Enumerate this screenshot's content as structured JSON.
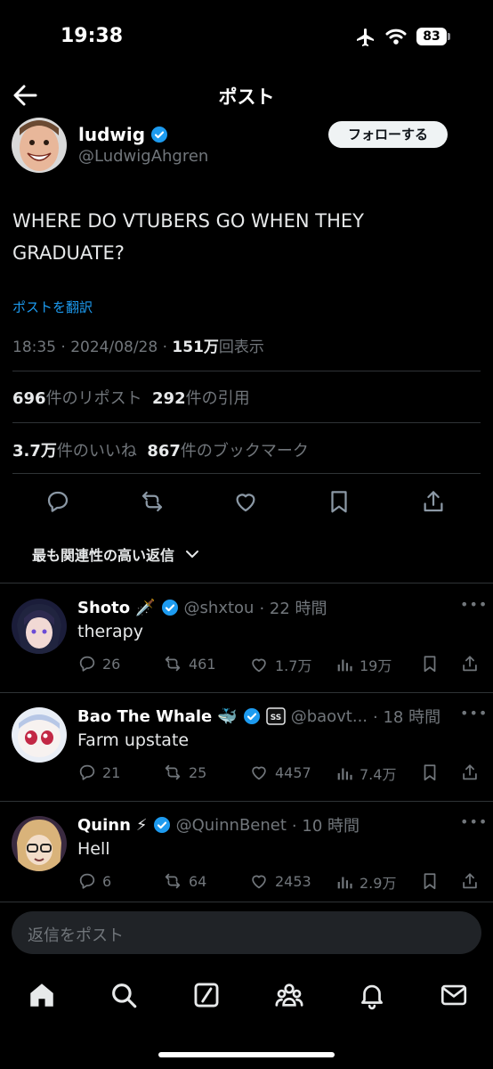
{
  "status_bar": {
    "time": "19:38",
    "battery": "83"
  },
  "nav": {
    "title": "ポスト"
  },
  "author": {
    "name": "ludwig",
    "handle": "@LudwigAhgren",
    "follow_label": "フォローする"
  },
  "tweet": {
    "text_line1": "WHERE DO VTUBERS GO WHEN THEY",
    "text_line2": "GRADUATE?",
    "translate": "ポストを翻訳",
    "timestamp": "18:35 · 2024/08/28 · ",
    "views_count": "151万",
    "views_label": "回表示"
  },
  "stats": {
    "reposts_count": "696",
    "reposts_label": "件のリポスト",
    "quotes_count": "292",
    "quotes_label": "件の引用",
    "likes_count": "3.7万",
    "likes_label": "件のいいね",
    "bookmarks_count": "867",
    "bookmarks_label": "件のブックマーク"
  },
  "sort_label": "最も関連性の高い返信",
  "replies": [
    {
      "name": "Shoto",
      "emoji": "🗡️",
      "handle": "@shxtou",
      "time": "· 22 時間",
      "text": "therapy",
      "replies": "26",
      "reposts": "461",
      "likes": "1.7万",
      "views": "19万"
    },
    {
      "name": "Bao The Whale",
      "emoji": "🐳",
      "handle": "@baovt...",
      "time": "· 18 時間",
      "text": "Farm upstate",
      "replies": "21",
      "reposts": "25",
      "likes": "4457",
      "views": "7.4万"
    },
    {
      "name": "Quinn",
      "emoji": "⚡",
      "handle": "@QuinnBenet",
      "time": "· 10 時間",
      "text": "Hell",
      "replies": "6",
      "reposts": "64",
      "likes": "2453",
      "views": "2.9万"
    }
  ],
  "composer": {
    "placeholder": "返信をポスト"
  },
  "more_label": "•••",
  "colors": {
    "background": "#000000",
    "accent": "#1d9bf0",
    "muted": "#71767b",
    "divider": "#2f3336"
  }
}
